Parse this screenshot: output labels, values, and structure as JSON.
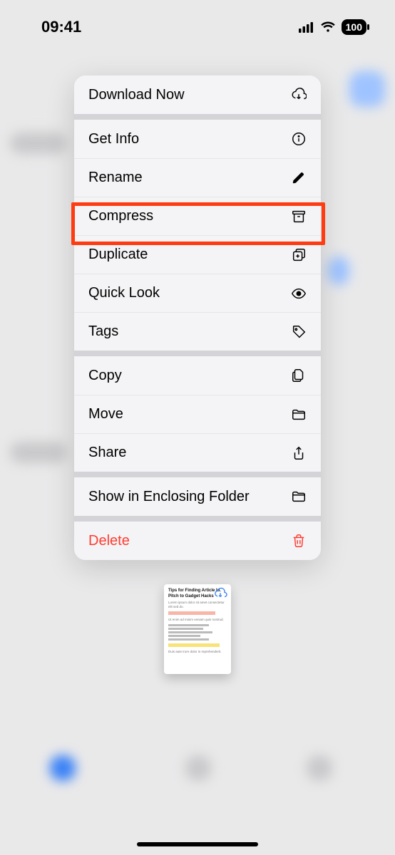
{
  "status": {
    "time": "09:41",
    "battery": "100"
  },
  "menu": {
    "download": "Download Now",
    "info": "Get Info",
    "rename": "Rename",
    "compress": "Compress",
    "duplicate": "Duplicate",
    "quicklook": "Quick Look",
    "tags": "Tags",
    "copy": "Copy",
    "move": "Move",
    "share": "Share",
    "enclosing": "Show in Enclosing Folder",
    "delete": "Delete"
  },
  "preview": {
    "title1": "Tips for Finding Article Id.",
    "title2": "Pitch to Gadget Hacks"
  }
}
